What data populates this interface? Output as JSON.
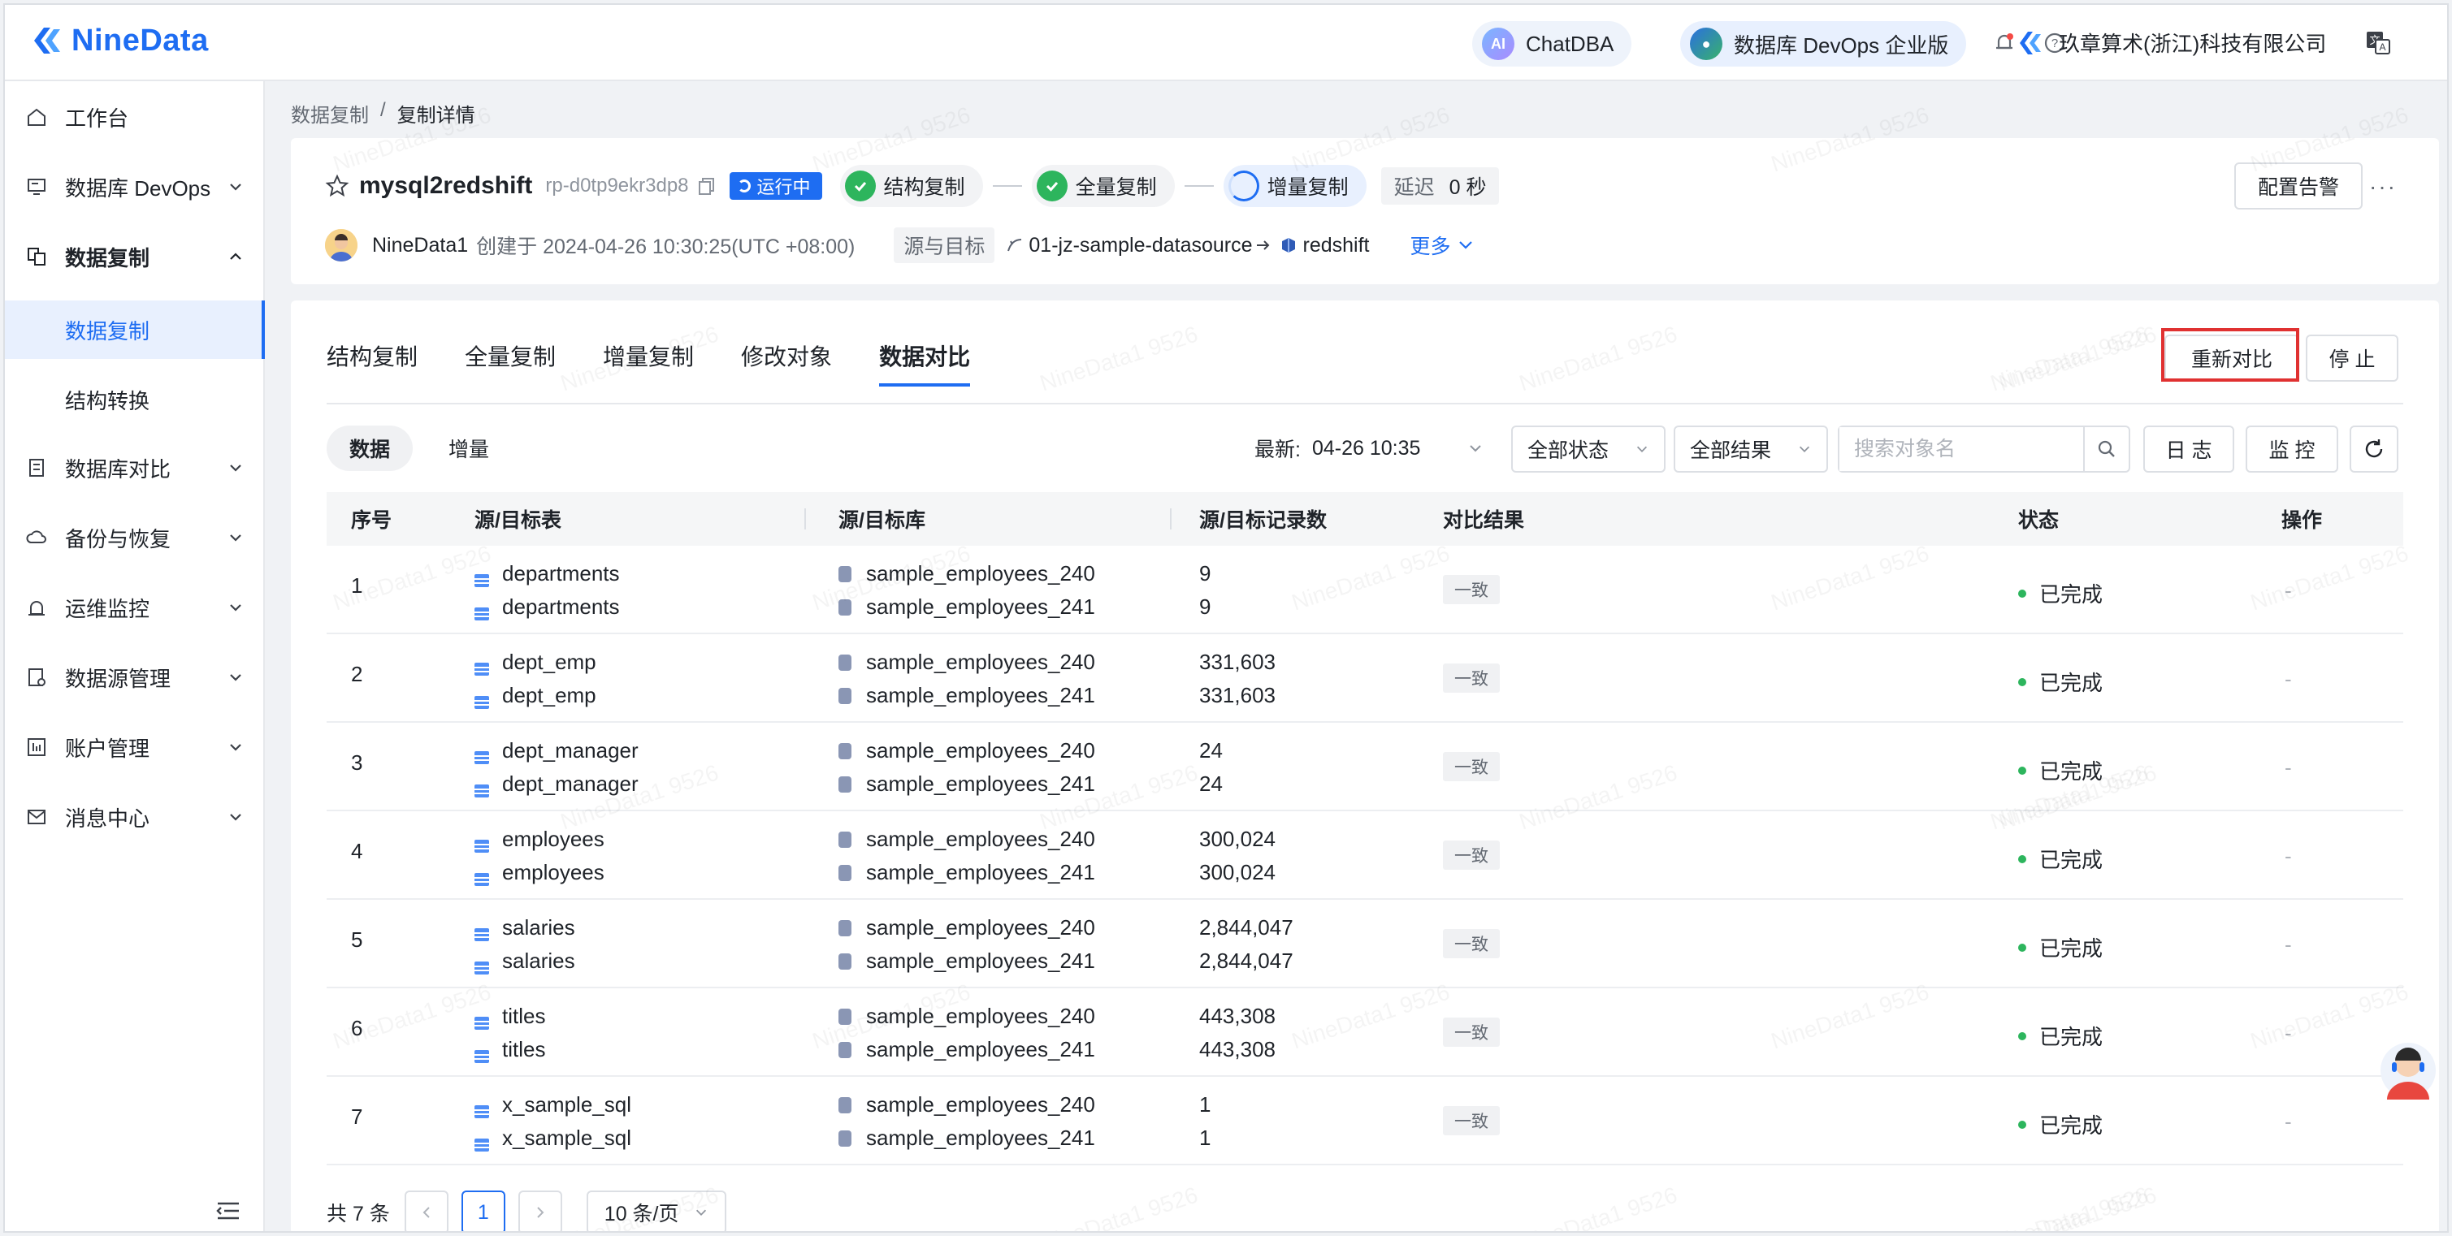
{
  "brand": {
    "name": "NineData"
  },
  "topbar": {
    "chatdba": "ChatDBA",
    "devops_edition": "数据库 DevOps 企业版",
    "company": "玖章算术(浙江)科技有限公司"
  },
  "sidebar": {
    "items": [
      {
        "label": "工作台",
        "icon": "home-icon"
      },
      {
        "label": "数据库 DevOps",
        "icon": "monitor-icon"
      },
      {
        "label": "数据复制",
        "icon": "replication-icon"
      },
      {
        "label": "数据库对比",
        "icon": "compare-icon"
      },
      {
        "label": "备份与恢复",
        "icon": "cloud-backup-icon"
      },
      {
        "label": "运维监控",
        "icon": "alarm-icon"
      },
      {
        "label": "数据源管理",
        "icon": "datasource-icon"
      },
      {
        "label": "账户管理",
        "icon": "account-icon"
      },
      {
        "label": "消息中心",
        "icon": "mail-icon"
      }
    ],
    "sub_items": [
      "数据复制",
      "结构转换"
    ]
  },
  "breadcrumb": {
    "parent": "数据复制",
    "separator": "/",
    "current": "复制详情"
  },
  "job": {
    "name": "mysql2redshift",
    "id": "rp-d0tp9ekr3dp8",
    "status": "运行中",
    "steps": [
      "结构复制",
      "全量复制",
      "增量复制"
    ],
    "delay_label": "延迟",
    "delay_value": "0 秒",
    "creator": "NineData1",
    "created_text": "创建于 2024-04-26 10:30:25(UTC +08:00)",
    "src_tgt_label": "源与目标",
    "source": "01-jz-sample-datasource",
    "target": "redshift",
    "more": "更多",
    "alert_button": "配置告警"
  },
  "tabs": [
    "结构复制",
    "全量复制",
    "增量复制",
    "修改对象",
    "数据对比"
  ],
  "active_tab": "数据对比",
  "actions": {
    "recompare": "重新对比",
    "stop": "停 止"
  },
  "segments": [
    "数据",
    "增量"
  ],
  "toolbar": {
    "latest_label": "最新:",
    "latest_value": "04-26 10:35",
    "status_filter": "全部状态",
    "result_filter": "全部结果",
    "search_placeholder": "搜索对象名",
    "log_button": "日 志",
    "monitor_button": "监 控"
  },
  "table": {
    "columns": [
      "序号",
      "源/目标表",
      "源/目标库",
      "源/目标记录数",
      "对比结果",
      "状态",
      "操作"
    ],
    "rows": [
      {
        "no": "1",
        "src_table": "departments",
        "tgt_table": "departments",
        "src_db": "sample_employees_240",
        "tgt_db": "sample_employees_241",
        "src_count": "9",
        "tgt_count": "9",
        "result": "一致",
        "status": "已完成",
        "op": "-"
      },
      {
        "no": "2",
        "src_table": "dept_emp",
        "tgt_table": "dept_emp",
        "src_db": "sample_employees_240",
        "tgt_db": "sample_employees_241",
        "src_count": "331,603",
        "tgt_count": "331,603",
        "result": "一致",
        "status": "已完成",
        "op": "-"
      },
      {
        "no": "3",
        "src_table": "dept_manager",
        "tgt_table": "dept_manager",
        "src_db": "sample_employees_240",
        "tgt_db": "sample_employees_241",
        "src_count": "24",
        "tgt_count": "24",
        "result": "一致",
        "status": "已完成",
        "op": "-"
      },
      {
        "no": "4",
        "src_table": "employees",
        "tgt_table": "employees",
        "src_db": "sample_employees_240",
        "tgt_db": "sample_employees_241",
        "src_count": "300,024",
        "tgt_count": "300,024",
        "result": "一致",
        "status": "已完成",
        "op": "-"
      },
      {
        "no": "5",
        "src_table": "salaries",
        "tgt_table": "salaries",
        "src_db": "sample_employees_240",
        "tgt_db": "sample_employees_241",
        "src_count": "2,844,047",
        "tgt_count": "2,844,047",
        "result": "一致",
        "status": "已完成",
        "op": "-"
      },
      {
        "no": "6",
        "src_table": "titles",
        "tgt_table": "titles",
        "src_db": "sample_employees_240",
        "tgt_db": "sample_employees_241",
        "src_count": "443,308",
        "tgt_count": "443,308",
        "result": "一致",
        "status": "已完成",
        "op": "-"
      },
      {
        "no": "7",
        "src_table": "x_sample_sql",
        "tgt_table": "x_sample_sql",
        "src_db": "sample_employees_240",
        "tgt_db": "sample_employees_241",
        "src_count": "1",
        "tgt_count": "1",
        "result": "一致",
        "status": "已完成",
        "op": "-"
      }
    ]
  },
  "pagination": {
    "total": "共 7 条",
    "current": "1",
    "page_size": "10 条/页"
  },
  "watermark": "NineData1 9526",
  "colors": {
    "primary": "#1e6df2",
    "success": "#2db55d",
    "highlight": "#e03131"
  }
}
